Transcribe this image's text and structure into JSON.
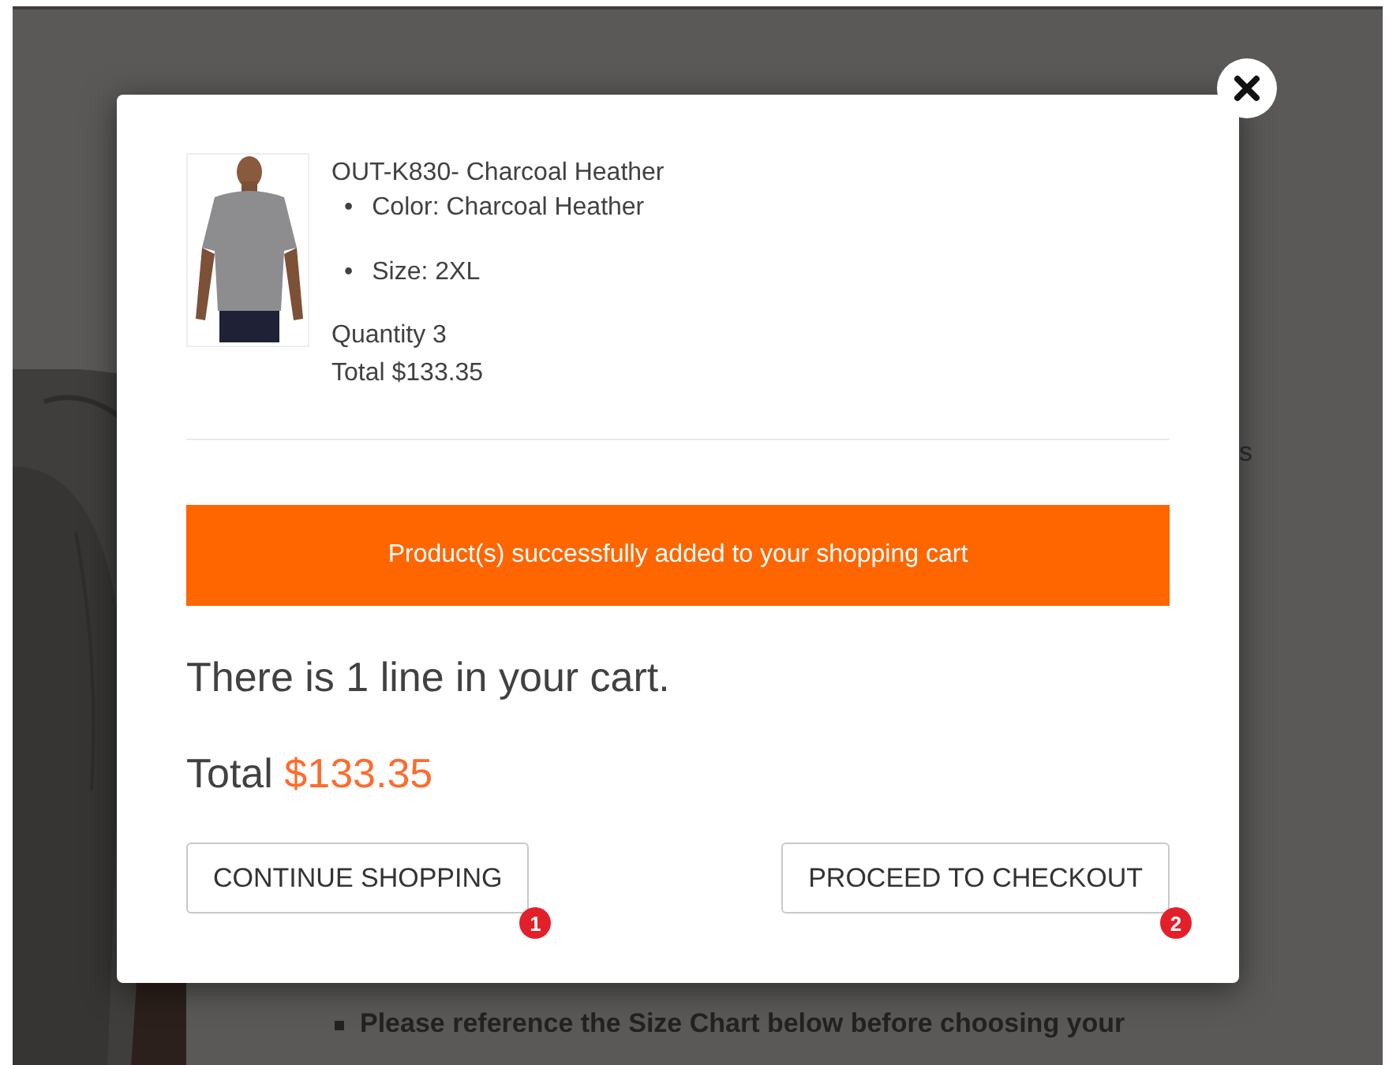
{
  "background_page": {
    "side_text_fragment": "s",
    "notes": [
      "Please reference the Size Chart below before choosing your"
    ]
  },
  "modal": {
    "product": {
      "kind": "picture",
      "title": "OUT-K830- Charcoal Heather",
      "attributes": [
        {
          "bullet": "•",
          "text": "Color: Charcoal Heather"
        },
        {
          "bullet": "•",
          "text": "Size: 2XL"
        }
      ],
      "quantity": "Quantity 3",
      "total": "Total $133.35"
    },
    "banner": "Product(s) successfully added to your shopping cart",
    "cart_summary": "There is 1 line in your cart.",
    "total_label": "Total",
    "total_value": "$133.35",
    "buttons": [
      {
        "label": "CONTINUE SHOPPING",
        "marker": "1"
      },
      {
        "label": "PROCEED TO CHECKOUT",
        "marker": "2"
      }
    ]
  }
}
